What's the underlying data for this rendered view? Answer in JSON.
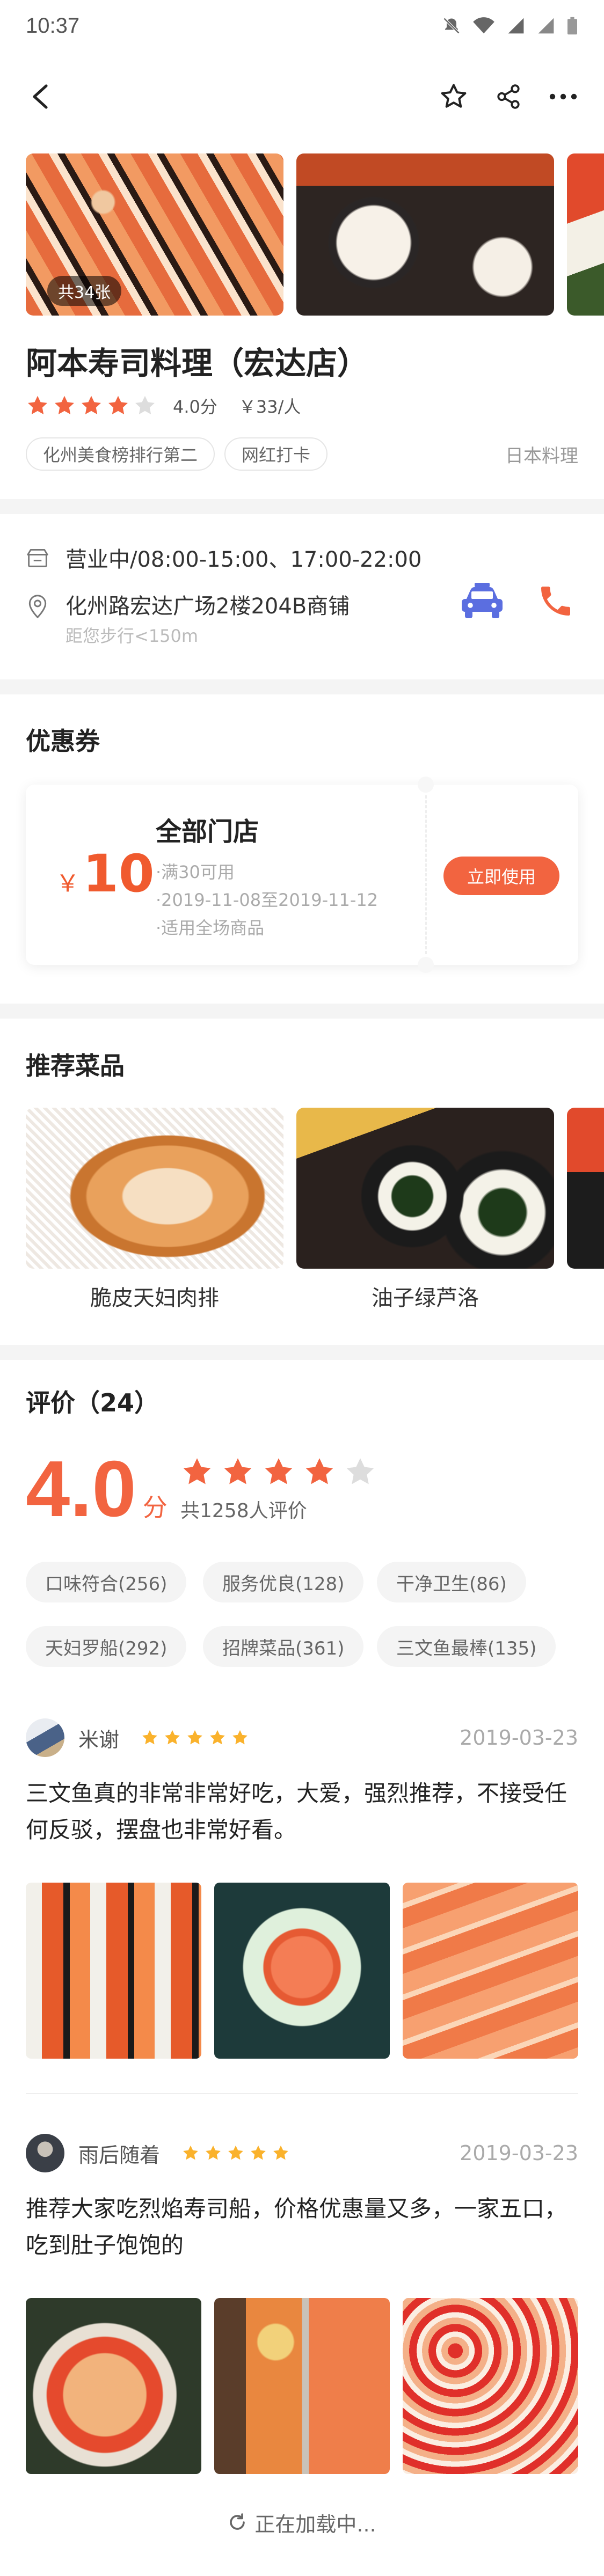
{
  "status_bar": {
    "time": "10:37"
  },
  "shop": {
    "photo_count": "共34张",
    "name": "阿本寿司料理（宏达店）",
    "rating": 4.0,
    "score_text": "4.0分",
    "price": "￥33/人",
    "tags": [
      "化州美食榜排行第二",
      "网红打卡"
    ],
    "cuisine": "日本料理"
  },
  "info": {
    "hours": "营业中/08:00-15:00、17:00-22:00",
    "address": "化州路宏达广场2楼204B商铺",
    "distance": "距您步行<150m"
  },
  "coupon": {
    "section_title": "优惠券",
    "currency": "￥",
    "amount": "10",
    "title": "全部门店",
    "lines": [
      "·满30可用",
      "·2019-11-08至2019-11-12",
      "·适用全场商品"
    ],
    "button": "立即使用"
  },
  "dishes": {
    "section_title": "推荐菜品",
    "items": [
      "脆皮天妇肉排",
      "油子绿芦洛"
    ]
  },
  "reviews": {
    "section_title": "评价（24）",
    "score": "4.0",
    "score_unit": "分",
    "rating": 4.0,
    "count_text": "共1258人评价",
    "chips": [
      "口味符合(256)",
      "服务优良(128)",
      "干净卫生(86)",
      "天妇罗船(292)",
      "招牌菜品(361)",
      "三文鱼最棒(135)"
    ],
    "items": [
      {
        "user": "米谢",
        "stars": 5,
        "date": "2019-03-23",
        "text": "三文鱼真的非常非常好吃，大爱，强烈推荐，不接受任何反驳，摆盘也非常好看。"
      },
      {
        "user": "雨后随着",
        "stars": 5,
        "date": "2019-03-23",
        "text": "推荐大家吃烈焰寿司船，价格优惠量又多，一家五口，吃到肚子饱饱的"
      }
    ]
  },
  "loading_text": "正在加载中...",
  "colors": {
    "accent": "#f26440",
    "star": "#f26440",
    "small_star": "#fab22c",
    "taxi": "#5b6ee0"
  }
}
